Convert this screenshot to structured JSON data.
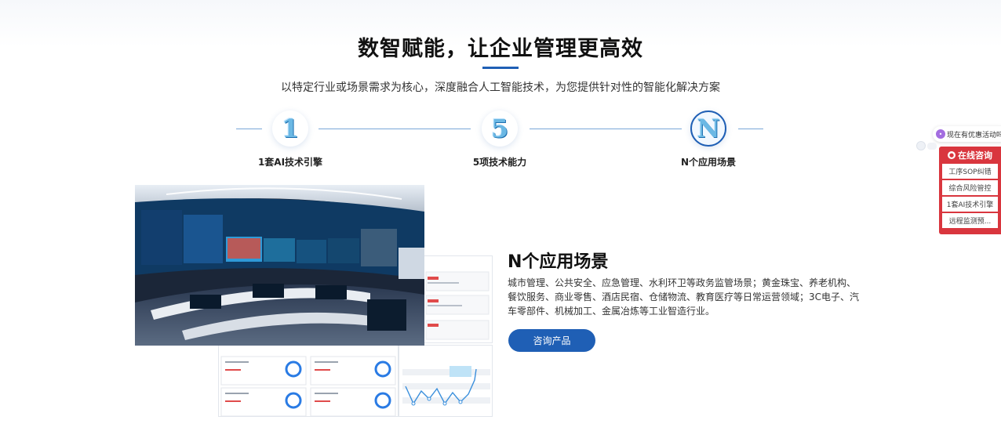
{
  "header": {
    "title": "数智赋能，让企业管理更高效",
    "subtitle": "以特定行业或场景需求为核心，深度融合人工智能技术，为您提供针对性的智能化解决方案"
  },
  "steps": [
    {
      "glyph": "1",
      "label": "1套AI技术引擎",
      "active": false
    },
    {
      "glyph": "5",
      "label": "5项技术能力",
      "active": false
    },
    {
      "glyph": "N",
      "label": "N个应用场景",
      "active": true
    }
  ],
  "content": {
    "title": "N个应用场景",
    "description": "城市管理、公共安全、应急管理、水利环卫等政务监管场景；黄金珠宝、养老机构、餐饮服务、商业零售、酒店民宿、仓储物流、教育医疗等日常运营领域；3C电子、汽车零部件、机械加工、金属冶炼等工业智造行业。",
    "button_label": "咨询产品"
  },
  "float_widget": {
    "promo_text": "现在有优惠活动吗",
    "panel_title": "在线咨询",
    "items": [
      "工序SOP纠错",
      "综合风险管控",
      "1套AI技术引擎",
      "远程监测预..."
    ]
  },
  "colors": {
    "accent": "#1f5fb5",
    "consult_red": "#d9363e"
  }
}
